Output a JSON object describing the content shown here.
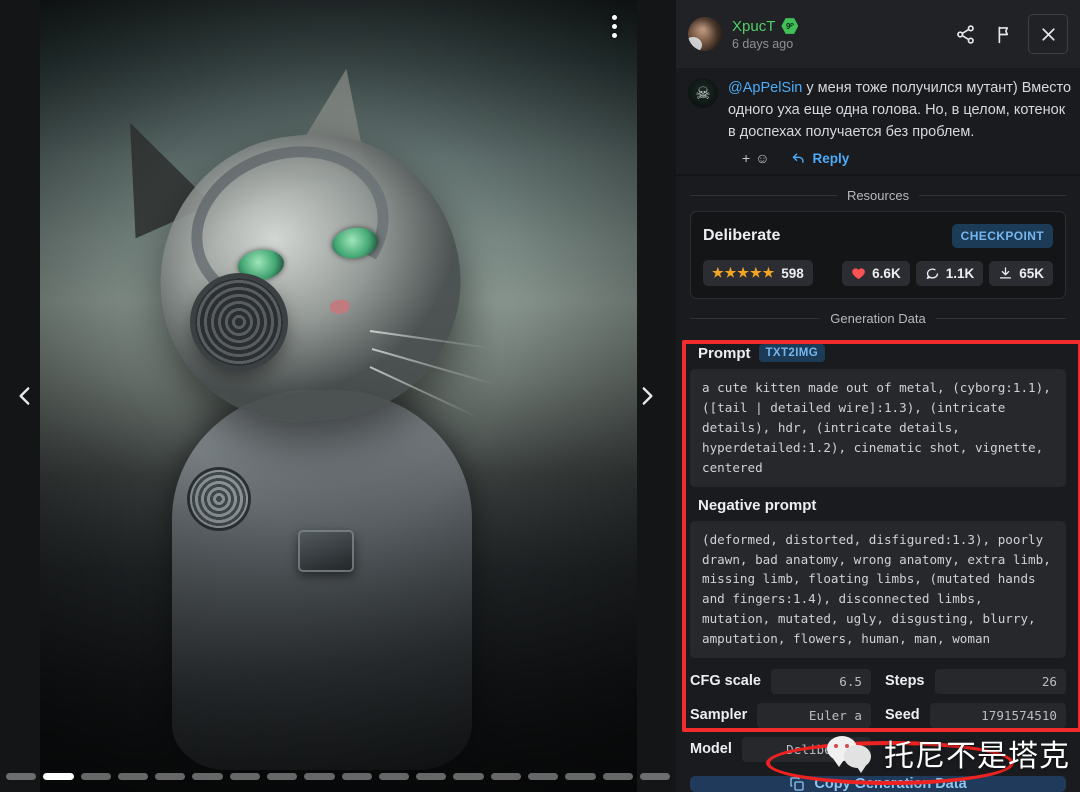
{
  "viewer": {
    "menu_icon": "vertical-dots-icon",
    "prev_icon": "chevron-left-icon",
    "next_icon": "chevron-right-icon",
    "carousel": {
      "total": 18,
      "active_index": 1
    },
    "image_alt": "a cute kitten made out of metal wearing cyborg headphones and armor"
  },
  "header": {
    "username": "XpucT",
    "verified_badge": "green-hex-badge",
    "timestamp": "6 days ago",
    "share_icon": "share-icon",
    "flag_icon": "flag-icon",
    "close_icon": "close-icon"
  },
  "comment": {
    "mention": "@ApPelSin",
    "line1": " у меня тоже получился мутант) Вместо",
    "line2": "одного уха еще одна голова. Но, в целом, котенок",
    "line3": "в доспехах получается без проблем.",
    "react_plus": "+",
    "react_emoji": "☺",
    "reply_label": "Reply"
  },
  "resources": {
    "section_title": "Resources",
    "card": {
      "name": "Deliberate",
      "type": "CHECKPOINT",
      "rating_stars": "★★★★★",
      "rating_count": "598",
      "likes": "6.6K",
      "comments": "1.1K",
      "downloads": "65K"
    }
  },
  "generation": {
    "section_title": "Generation Data",
    "prompt_label": "Prompt",
    "prompt_tag": "TXT2IMG",
    "prompt_text": "a cute kitten made out of metal, (cyborg:1.1), ([tail | detailed wire]:1.3), (intricate details), hdr, (intricate details, hyperdetailed:1.2), cinematic shot, vignette, centered",
    "negative_label": "Negative prompt",
    "negative_text": "(deformed, distorted, disfigured:1.3), poorly drawn, bad anatomy, wrong anatomy, extra limb, missing limb, floating limbs, (mutated hands and fingers:1.4), disconnected limbs, mutation, mutated, ugly, disgusting, blurry, amputation, flowers, human, man, woman",
    "fields": [
      {
        "key": "CFG scale",
        "value": "6.5"
      },
      {
        "key": "Steps",
        "value": "26"
      },
      {
        "key": "Sampler",
        "value": "Euler a"
      },
      {
        "key": "Seed",
        "value": "1791574510"
      },
      {
        "key": "Model",
        "value": "Deliberate"
      }
    ],
    "copy_label": "Copy Generation Data",
    "copy_icon": "copy-icon"
  },
  "annotations": {
    "rect_color": "#f22c2c",
    "ellipse_color": "#ef2222"
  },
  "watermark": {
    "logo": "wechat-logo",
    "text": "托尼不是塔克"
  }
}
